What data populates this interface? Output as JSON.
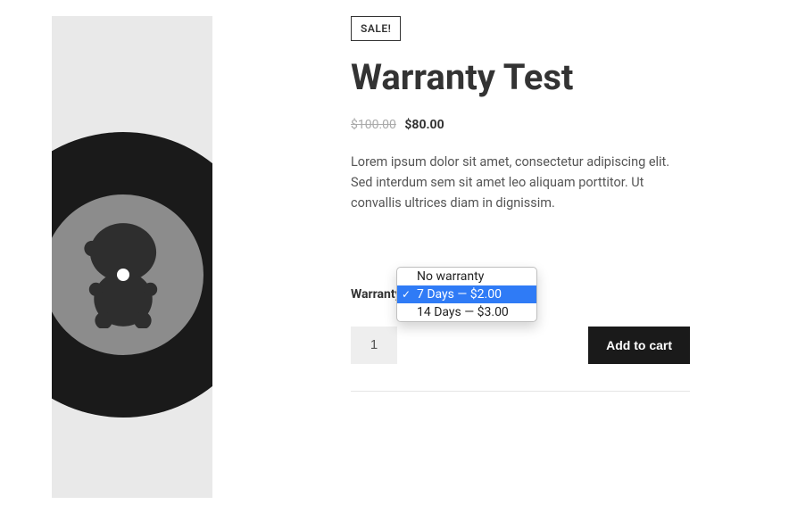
{
  "badge": "SALE!",
  "title": "Warranty Test",
  "price_old": "$100.00",
  "price_new": "$80.00",
  "description": "Lorem ipsum dolor sit amet, consectetur adipiscing elit. Sed interdum sem sit amet leo aliquam porttitor. Ut convallis ultrices diam in dignissim.",
  "warranty_label": "Warranty",
  "quantity": "1",
  "add_to_cart": "Add to cart",
  "dropdown": {
    "options": [
      {
        "label": "No warranty",
        "selected": false
      },
      {
        "label": "7 Days — $2.00",
        "selected": true
      },
      {
        "label": "14 Days — $3.00",
        "selected": false
      }
    ]
  }
}
